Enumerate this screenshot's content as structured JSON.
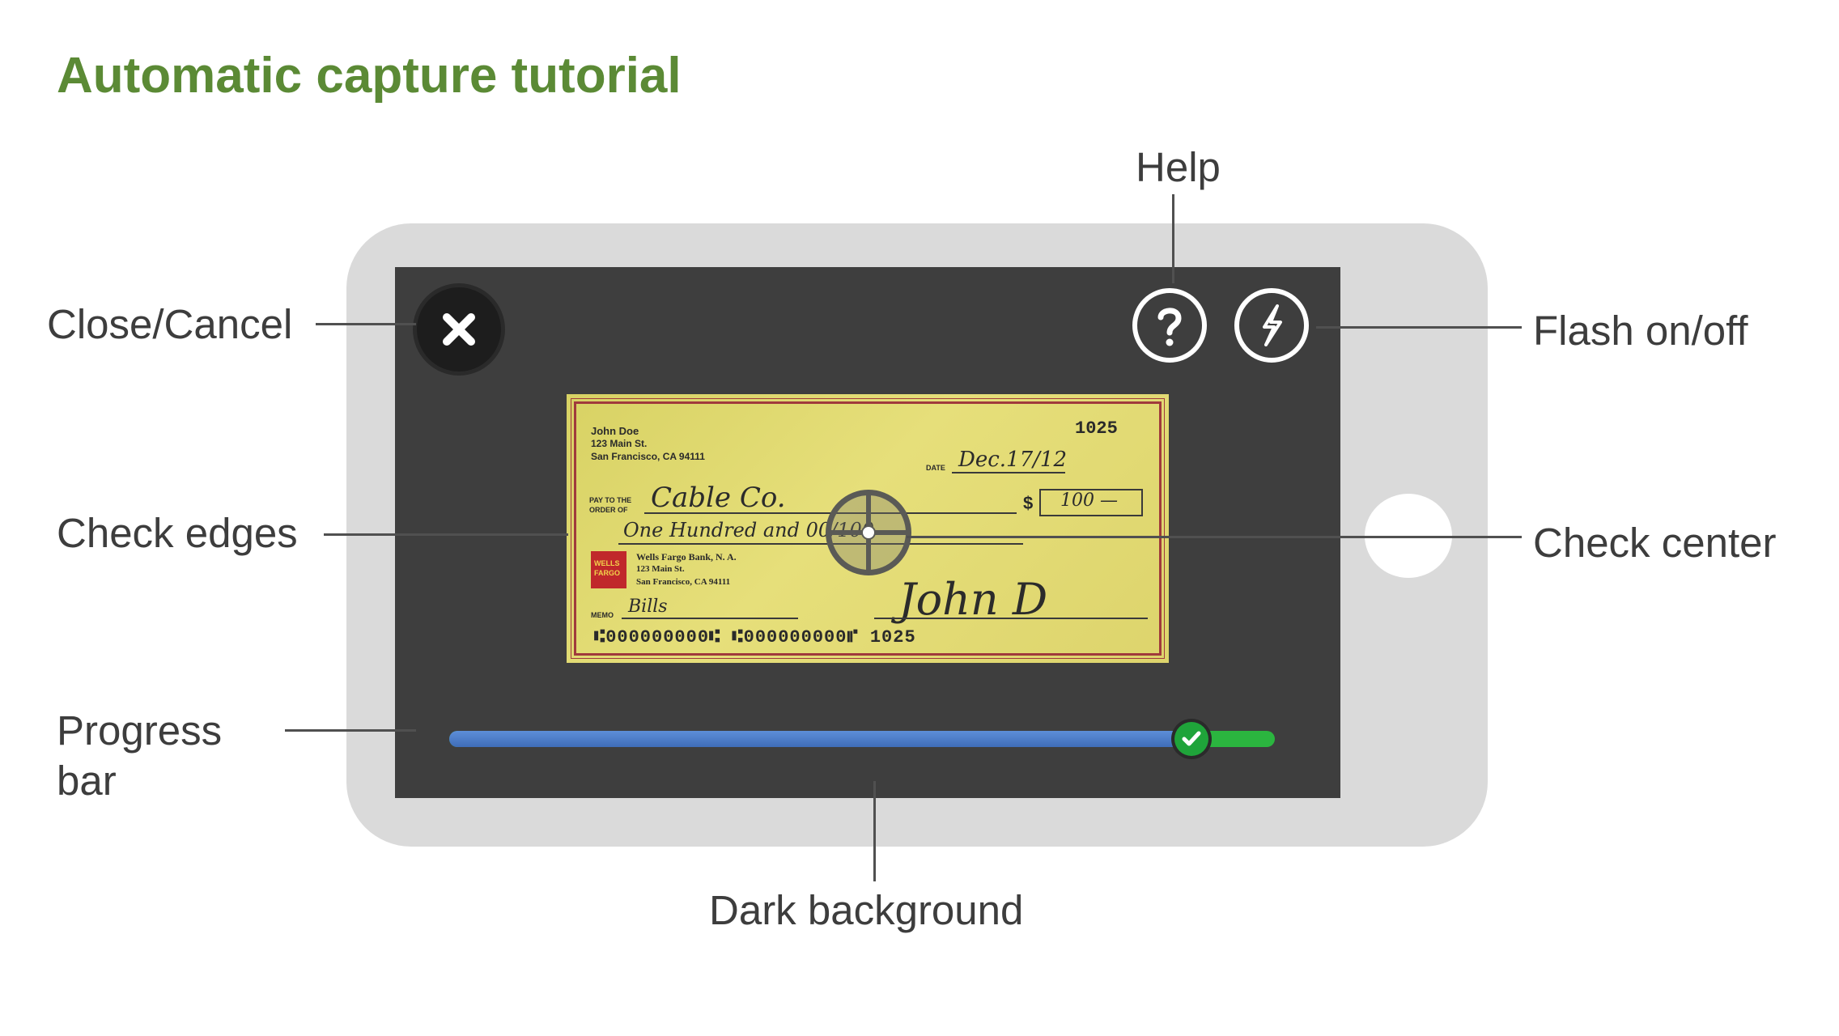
{
  "title": "Automatic capture tutorial",
  "callouts": {
    "help": "Help",
    "close_cancel": "Close/Cancel",
    "flash": "Flash on/off",
    "check_edges": "Check edges",
    "check_center": "Check center",
    "progress_line1": "Progress",
    "progress_line2": "bar",
    "dark_background": "Dark background"
  },
  "check": {
    "name": "John Doe",
    "address1": "123 Main St.",
    "address2": "San Francisco, CA 94111",
    "number": "1025",
    "date_label": "DATE",
    "date": "Dec.17/12",
    "pay_label1": "PAY TO THE",
    "pay_label2": "ORDER OF",
    "payee": "Cable Co.",
    "dollar_sign": "$",
    "amount": "100 —",
    "amount_words": "One Hundred and 00/100",
    "bank_logo1": "WELLS",
    "bank_logo2": "FARGO",
    "bank_name": "Wells Fargo Bank, N. A.",
    "bank_address1": "123 Main St.",
    "bank_address2": "San Francisco, CA 94111",
    "memo_label": "MEMO",
    "memo": "Bills",
    "micr": "⑆000000000⑆ ⑆000000000⑈ 1025",
    "signature": "John D"
  },
  "progress": {
    "value": 0.87,
    "status": "complete"
  },
  "icons": {
    "close": "close-icon",
    "help": "question-mark-icon",
    "flash": "lightning-bolt-icon",
    "progress_knob": "checkmark-icon"
  },
  "colors": {
    "title": "#5b8a35",
    "screen_bg": "#3e3e3e",
    "phone_frame": "#dadada",
    "progress_fill": "#3f6db8",
    "progress_complete": "#2bb53f"
  }
}
